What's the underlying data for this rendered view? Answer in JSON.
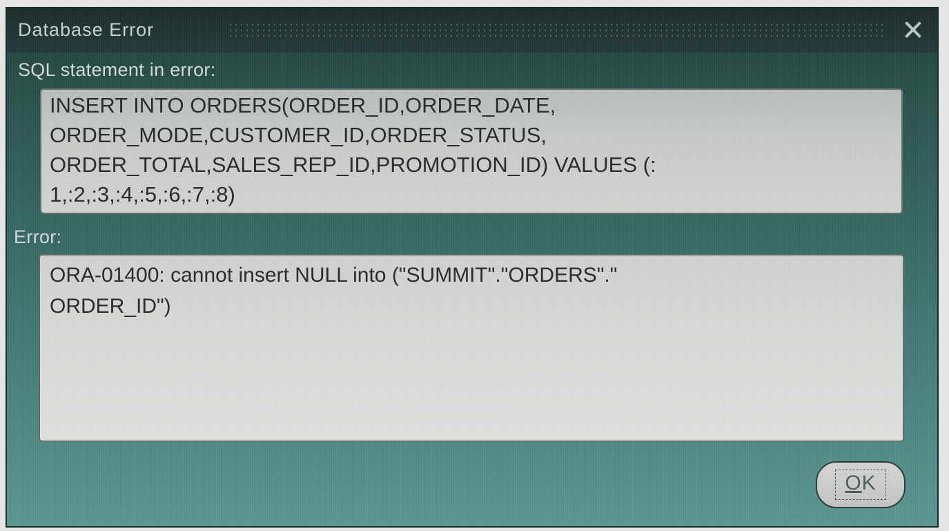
{
  "window": {
    "title": "Database Error",
    "close_icon": "close-icon"
  },
  "sql_section": {
    "label": "SQL statement in error:",
    "statement": "INSERT INTO ORDERS(ORDER_ID,ORDER_DATE,\nORDER_MODE,CUSTOMER_ID,ORDER_STATUS,\nORDER_TOTAL,SALES_REP_ID,PROMOTION_ID) VALUES (:\n1,:2,:3,:4,:5,:6,:7,:8)"
  },
  "error_section": {
    "label": "Error:",
    "message": "ORA-01400: cannot insert NULL into (\"SUMMIT\".\"ORDERS\".\"\nORDER_ID\")"
  },
  "ok_button": {
    "label": "OK",
    "mnemonic": "O",
    "rest": "K"
  },
  "colors": {
    "dialog_top": "#1f3e3a",
    "dialog_bottom": "#5b9690",
    "titlebar": "#1b2c2a",
    "textbox": "#d3d5d2",
    "text": "#282a28"
  }
}
